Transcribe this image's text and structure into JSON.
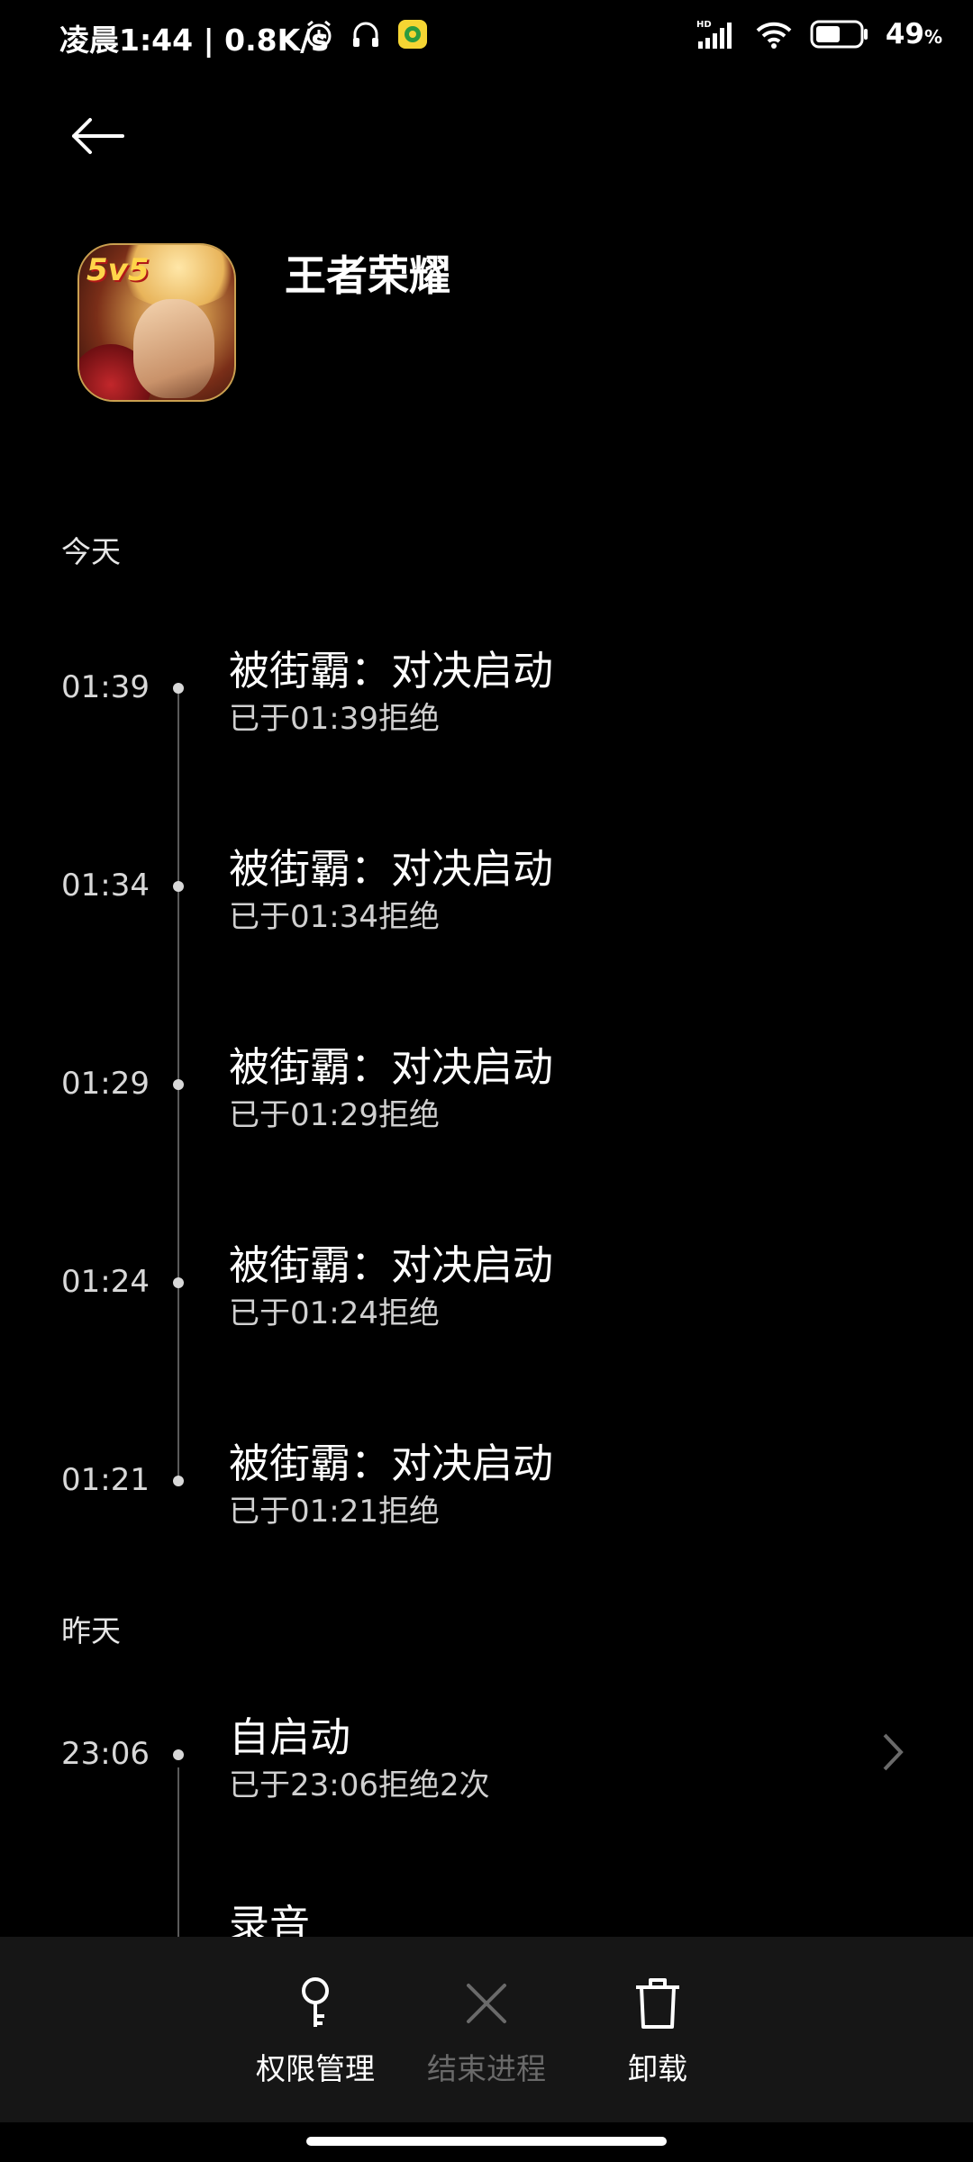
{
  "status_bar": {
    "time_speed": "凌晨1:44 | 0.8K/s",
    "battery_percent": "49",
    "battery_unit": "%",
    "battery_level": 0.49,
    "icons": [
      "alarm-icon",
      "headset-icon",
      "app-notification-icon",
      "hd-signal-icon",
      "wifi-icon",
      "battery-icon"
    ]
  },
  "header": {
    "back_icon": "arrow-left-icon",
    "app_name": "王者荣耀",
    "app_icon_badge": "5v5"
  },
  "sections": [
    {
      "label": "今天",
      "entries": [
        {
          "time": "01:39",
          "title": "被街霸：对决启动",
          "subtitle": "已于01:39拒绝"
        },
        {
          "time": "01:34",
          "title": "被街霸：对决启动",
          "subtitle": "已于01:34拒绝"
        },
        {
          "time": "01:29",
          "title": "被街霸：对决启动",
          "subtitle": "已于01:29拒绝"
        },
        {
          "time": "01:24",
          "title": "被街霸：对决启动",
          "subtitle": "已于01:24拒绝"
        },
        {
          "time": "01:21",
          "title": "被街霸：对决启动",
          "subtitle": "已于01:21拒绝"
        }
      ]
    },
    {
      "label": "昨天",
      "entries": [
        {
          "time": "23:06",
          "title": "自启动",
          "subtitle": "已于23:06拒绝2次",
          "has_chevron": true
        },
        {
          "time": "",
          "title": "录音",
          "subtitle": ""
        }
      ]
    }
  ],
  "bottom_actions": [
    {
      "label": "权限管理",
      "icon": "key-icon",
      "enabled": true
    },
    {
      "label": "结束进程",
      "icon": "close-icon",
      "enabled": false
    },
    {
      "label": "卸载",
      "icon": "trash-icon",
      "enabled": true
    }
  ],
  "colors": {
    "background": "#000000",
    "bottom_bar": "#161616",
    "disabled_text": "#6a6a6a",
    "timeline": "#5a5a5a"
  }
}
